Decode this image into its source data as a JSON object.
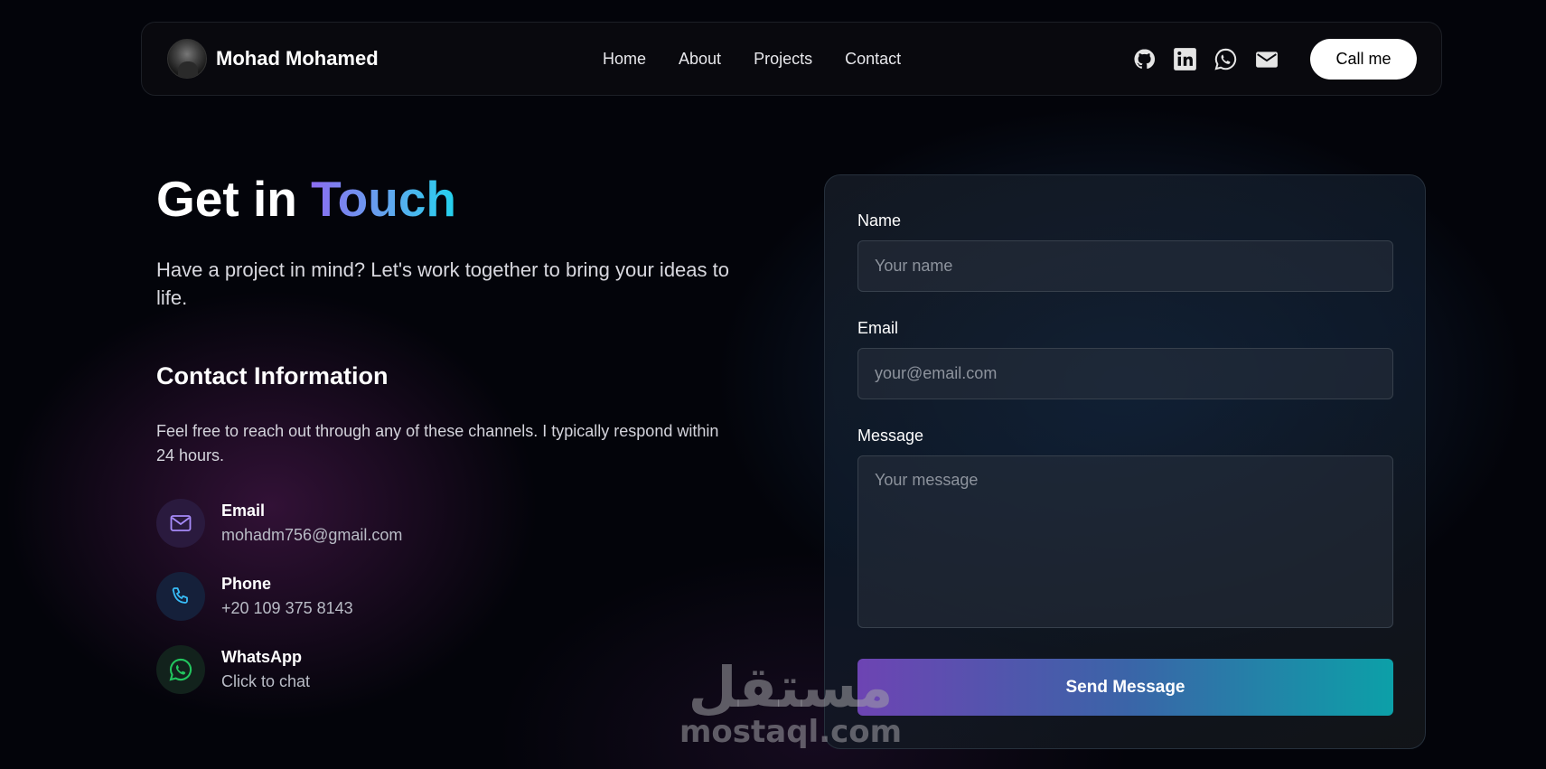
{
  "navbar": {
    "brand_name": "Mohad Mohamed",
    "links": [
      "Home",
      "About",
      "Projects",
      "Contact"
    ],
    "socials": [
      "github-icon",
      "linkedin-icon",
      "whatsapp-icon",
      "mail-icon"
    ],
    "call_label": "Call me"
  },
  "hero": {
    "title_plain": "Get in ",
    "title_accent": "Touch",
    "subtitle": "Have a project in mind? Let's work together to bring your ideas to life."
  },
  "contact_info": {
    "title": "Contact Information",
    "description": "Feel free to reach out through any of these channels. I typically respond within 24 hours.",
    "items": [
      {
        "label": "Email",
        "value": "mohadm756@gmail.com",
        "icon": "mail-icon",
        "color": "#a78bfa"
      },
      {
        "label": "Phone",
        "value": "+20 109 375 8143",
        "icon": "phone-icon",
        "color": "#38bdf8"
      },
      {
        "label": "WhatsApp",
        "value": "Click to chat",
        "icon": "whatsapp-icon",
        "color": "#22c55e"
      }
    ]
  },
  "form": {
    "name_label": "Name",
    "name_placeholder": "Your name",
    "email_label": "Email",
    "email_placeholder": "your@email.com",
    "message_label": "Message",
    "message_placeholder": "Your message",
    "submit_label": "Send Message"
  },
  "watermark": {
    "arabic": "مستقل",
    "latin": "mostaql.com"
  }
}
